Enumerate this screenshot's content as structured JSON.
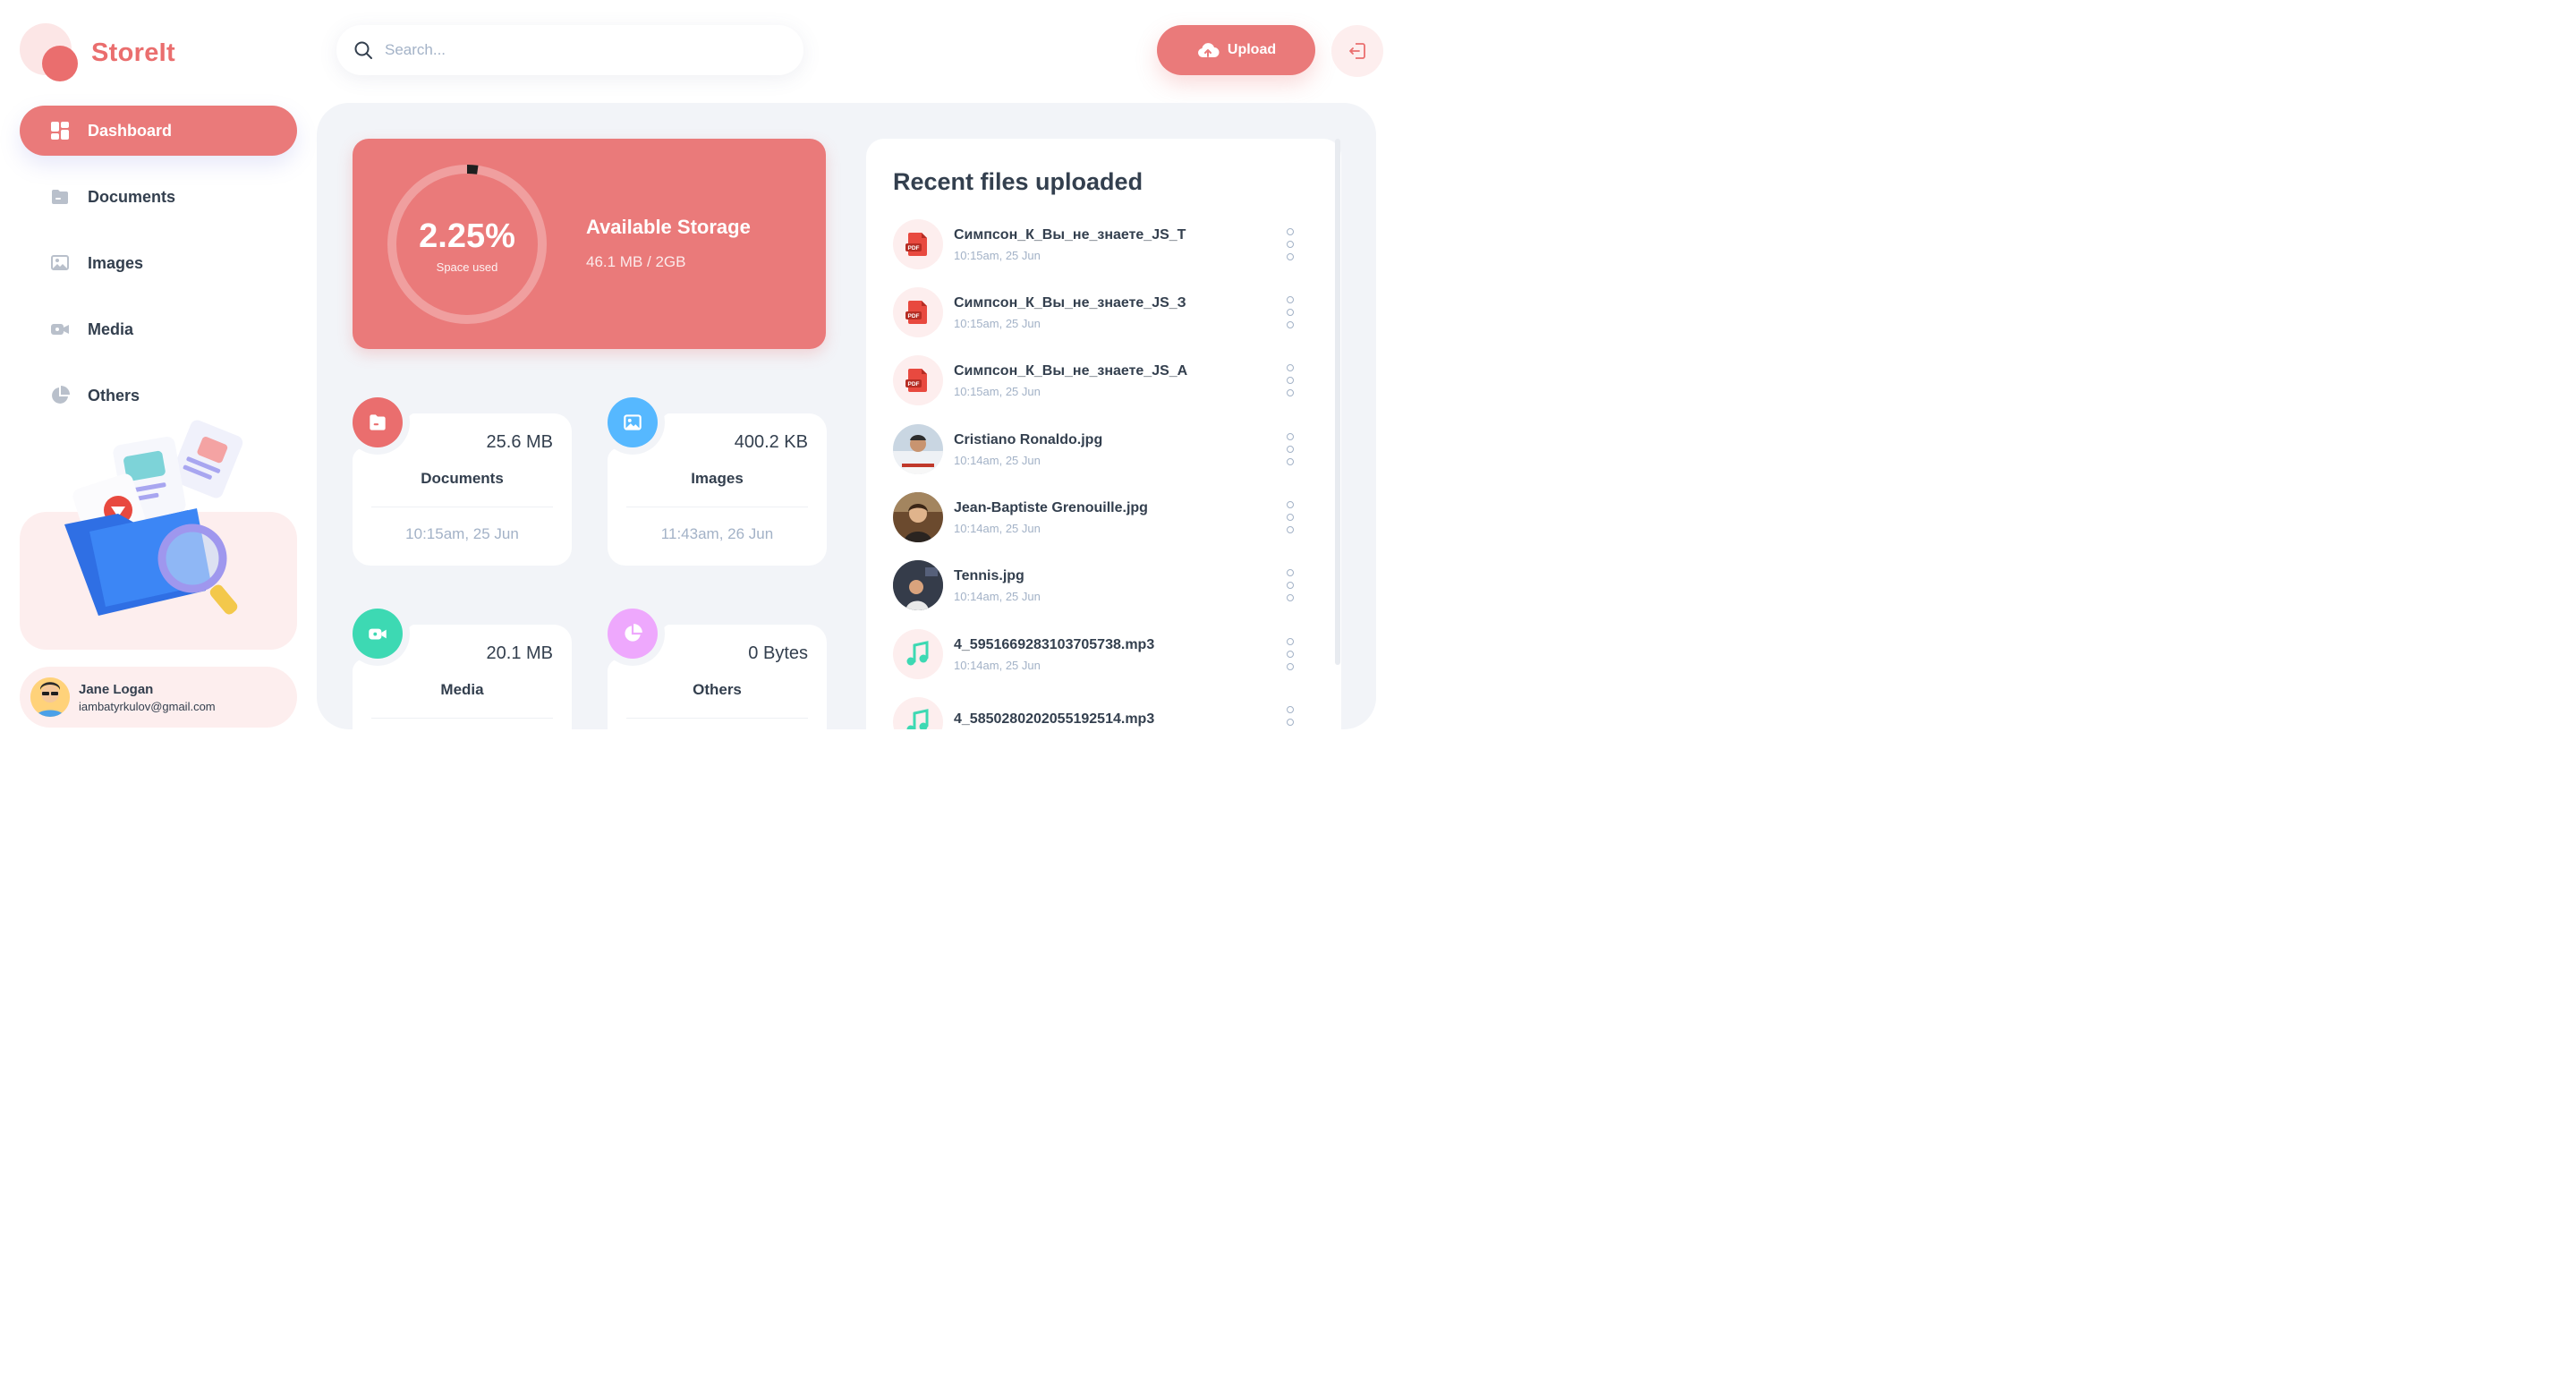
{
  "app": {
    "name": "StoreIt"
  },
  "colors": {
    "brand": "#ea7a7a",
    "brand_light": "#fdeeee",
    "text": "#333f4e",
    "muted": "#a3b2c7",
    "documents": "#ea6e6e",
    "images": "#56b8ff",
    "media": "#3dd9b3",
    "others": "#eea8fd"
  },
  "search": {
    "placeholder": "Search..."
  },
  "header": {
    "upload_label": "Upload"
  },
  "sidebar": {
    "items": [
      {
        "label": "Dashboard",
        "icon": "dashboard-icon",
        "active": true
      },
      {
        "label": "Documents",
        "icon": "documents-icon",
        "active": false
      },
      {
        "label": "Images",
        "icon": "images-icon",
        "active": false
      },
      {
        "label": "Media",
        "icon": "video-icon",
        "active": false
      },
      {
        "label": "Others",
        "icon": "pie-icon",
        "active": false
      }
    ]
  },
  "user": {
    "name": "Jane Logan",
    "email": "iambatyrkulov@gmail.com"
  },
  "storage": {
    "percent_label": "2.25%",
    "percent_value": 2.25,
    "caption": "Space used",
    "title": "Available Storage",
    "size": "46.1 MB / 2GB"
  },
  "summaries": [
    {
      "label": "Documents",
      "size": "25.6 MB",
      "date": "10:15am, 25 Jun",
      "icon": "documents-icon"
    },
    {
      "label": "Images",
      "size": "400.2 KB",
      "date": "11:43am, 26 Jun",
      "icon": "images-icon"
    },
    {
      "label": "Media",
      "size": "20.1 MB",
      "date": "",
      "icon": "video-icon"
    },
    {
      "label": "Others",
      "size": "0 Bytes",
      "date": "",
      "icon": "pie-icon"
    }
  ],
  "recent": {
    "title": "Recent files uploaded",
    "files": [
      {
        "name": "Симпсон_К_Вы_не_знаете_JS_Т",
        "time": "10:15am, 25 Jun",
        "type": "pdf",
        "icon": "pdf-icon"
      },
      {
        "name": "Симпсон_К_Вы_не_знаете_JS_З",
        "time": "10:15am, 25 Jun",
        "type": "pdf",
        "icon": "pdf-icon"
      },
      {
        "name": "Симпсон_К_Вы_не_знаете_JS_А",
        "time": "10:15am, 25 Jun",
        "type": "pdf",
        "icon": "pdf-icon"
      },
      {
        "name": "Cristiano Ronaldo.jpg",
        "time": "10:14am, 25 Jun",
        "type": "photo",
        "icon": "photo-thumbnail"
      },
      {
        "name": "Jean-Baptiste Grenouille.jpg",
        "time": "10:14am, 25 Jun",
        "type": "photo",
        "icon": "photo-thumbnail"
      },
      {
        "name": "Tennis.jpg",
        "time": "10:14am, 25 Jun",
        "type": "photo",
        "icon": "photo-thumbnail"
      },
      {
        "name": "4_5951669283103705738.mp3",
        "time": "10:14am, 25 Jun",
        "type": "audio",
        "icon": "music-note-icon"
      },
      {
        "name": "4_5850280202055192514.mp3",
        "time": "",
        "type": "audio",
        "icon": "music-note-icon"
      }
    ]
  }
}
